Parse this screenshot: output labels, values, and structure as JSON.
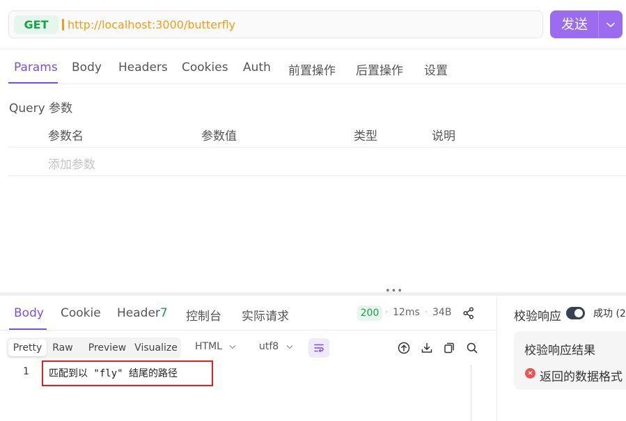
{
  "request": {
    "method": "GET",
    "url": "http://localhost:3000/butterfly",
    "send_label": "发送",
    "send_arrow": "⌄"
  },
  "request_tabs": [
    {
      "label": "Params",
      "active": true
    },
    {
      "label": "Body"
    },
    {
      "label": "Headers"
    },
    {
      "label": "Cookies"
    },
    {
      "label": "Auth"
    },
    {
      "label": "前置操作"
    },
    {
      "label": "后置操作"
    },
    {
      "label": "设置"
    }
  ],
  "params": {
    "section_title": "Query 参数",
    "columns": [
      "参数名",
      "参数值",
      "类型",
      "说明"
    ],
    "add_placeholder": "添加参数"
  },
  "splitter_handle": "•••",
  "response_tabs": {
    "body": "Body",
    "cookie": "Cookie",
    "header": "Header",
    "header_count": "7",
    "console": "控制台",
    "actual_request": "实际请求"
  },
  "response_meta": {
    "status": "200",
    "time": "12ms",
    "size": "34B",
    "separator": "·"
  },
  "view_modes": {
    "pretty": "Pretty",
    "raw": "Raw",
    "preview": "Preview",
    "visualize": "Visualize"
  },
  "format": {
    "selected": "HTML",
    "chevron": "⌄"
  },
  "encoding": {
    "selected": "utf8",
    "chevron": "⌄"
  },
  "editor": {
    "lines": [
      {
        "number": "1",
        "text": "匹配到以 \"fly\" 结尾的路径"
      }
    ]
  },
  "validation": {
    "title": "校验响应",
    "toggle_label": "成功 (2",
    "toggle_on": true,
    "result_title": "校验响应结果",
    "error_text": "返回的数据格式",
    "error_glyph": "×"
  },
  "colors": {
    "accent": "#7b4fe0",
    "send_button": "#9b6cf0",
    "success": "#16a34a",
    "url": "#f39c12",
    "error": "#ef5350",
    "highlight_box": "#e02020"
  }
}
